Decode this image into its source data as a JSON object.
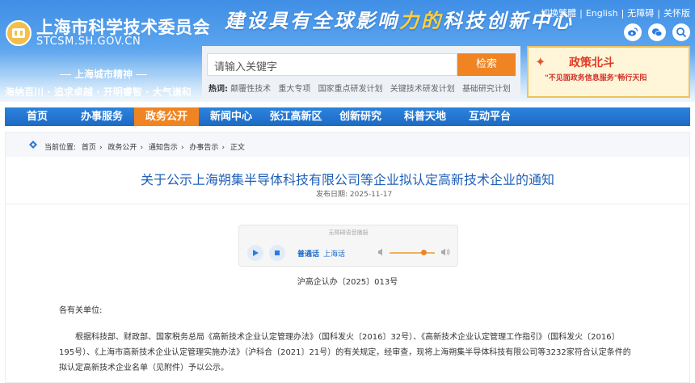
{
  "header": {
    "site_name_cn": "上海市科学技术委员会",
    "site_name_en": "STCSM.SH.GOV.CN",
    "slogan_part1": "建设具有全球影响",
    "slogan_highlight": "力的",
    "slogan_part2": "科技创新中心",
    "spirit_title": "上海城市精神",
    "spirit_text": "海纳百川 · 追求卓越 · 开明睿智 · 大气谦和",
    "toplinks": [
      "切换繁體",
      "English",
      "无障碍",
      "关怀版"
    ],
    "social_icons": [
      "weibo-icon",
      "wechat-icon",
      "search-icon"
    ]
  },
  "search": {
    "placeholder": "请输入关键字",
    "button_label": "检索",
    "hot_label": "热词:",
    "hot_words": [
      "颠覆性技术",
      "重大专项",
      "国家重点研发计划",
      "关键技术研发计划",
      "基础研究计划"
    ]
  },
  "promo": {
    "title": "政策北斗",
    "subtitle": "\"不见面政务信息服务\"畅行天阳"
  },
  "nav": {
    "items": [
      "首页",
      "办事服务",
      "政务公开",
      "新闻中心",
      "张江高新区",
      "创新研究",
      "科普天地",
      "互动平台"
    ],
    "active_index": 2
  },
  "breadcrumb": {
    "prefix": "当前位置:",
    "items": [
      "首页",
      "政务公开",
      "通知告示",
      "办事告示",
      "正文"
    ],
    "separator": "›"
  },
  "article": {
    "title": "关于公示上海朔集半导体科技有限公司等企业拟认定高新技术企业的通知",
    "date_label": "发布日期:",
    "date": "2025-11-17",
    "player_label": "无障碍语音播报",
    "lang_mandarin": "普通话",
    "lang_shanghai": "上海话",
    "volume_percent": 75,
    "doc_number": "沪高企认办〔2025〕013号",
    "salutation": "各有关单位:",
    "paragraph": "根据科技部、财政部、国家税务总局《高新技术企业认定管理办法》（国科发火〔2016〕32号）、《高新技术企业认定管理工作指引》（国科发火〔2016〕195号）、《上海市高新技术企业认定管理实施办法》（沪科合〔2021〕21号）的有关规定，经审查，现将上海朔集半导体科技有限公司等3232家符合认定条件的拟认定高新技术企业名单（见附件）予以公示。"
  },
  "colors": {
    "primary_blue": "#1c6ac3",
    "active_orange": "#f08422",
    "title_blue": "#1f5fb8"
  }
}
